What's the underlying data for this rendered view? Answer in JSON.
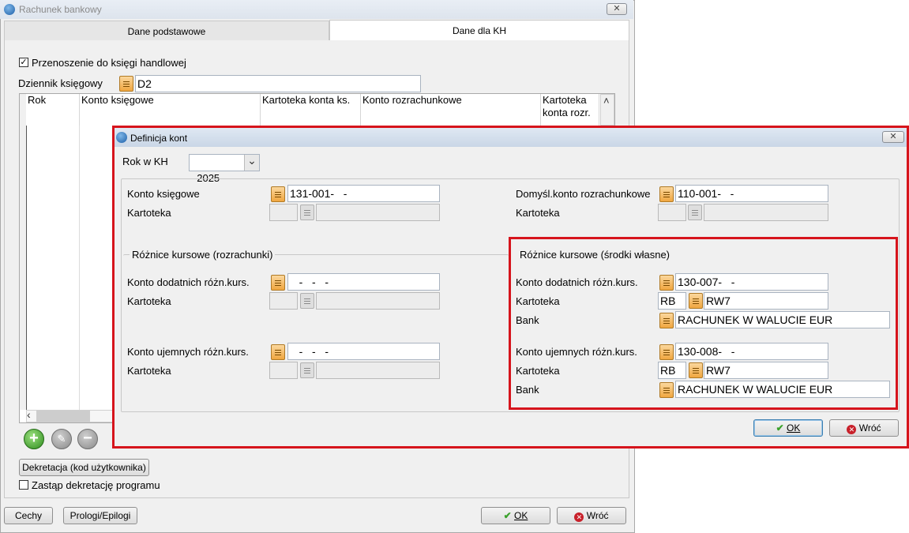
{
  "back_window": {
    "title": "Rachunek bankowy",
    "close": "✕",
    "tabs": [
      "Dane podstawowe",
      "Dane dla KH"
    ],
    "transfer_checkbox": {
      "label": "Przenoszenie do księgi handlowej",
      "checked": true,
      "mark": "✓"
    },
    "journal": {
      "label": "Dziennik księgowy",
      "value": "D2"
    },
    "grid": {
      "columns": [
        "Rok",
        "Konto księgowe",
        "Kartoteka konta ks.",
        "Konto rozrachunkowe",
        "Kartoteka konta rozr."
      ],
      "scroll_left": "‹",
      "scroll_up": "˄"
    },
    "add_icon": "+",
    "edit_icon": "✎",
    "remove_icon": "−",
    "decree_button": "Dekretacja (kod użytkownika)",
    "replace_checkbox": {
      "label": "Zastąp dekretację programu",
      "checked": false
    },
    "buttons": {
      "features": "Cechy",
      "prologs": "Prologi/Epilogi",
      "ok": "OK",
      "back": "Wróć"
    }
  },
  "dialog": {
    "title": "Definicja kont",
    "close": "✕",
    "year": {
      "label": "Rok w KH",
      "value": "2025",
      "arrow": "⌄"
    },
    "account": {
      "label": "Konto księgowe",
      "value": "131-001-   -",
      "card_label": "Kartoteka"
    },
    "default_settlement": {
      "label": "Domyśl.konto rozrachunkowe",
      "value": "110-001-   -",
      "card_label": "Kartoteka"
    },
    "fx_settlements": {
      "title": "Różnice kursowe (rozrachunki)",
      "positive": {
        "label": "Konto dodatnich różn.kurs.",
        "value": "   -   -   -",
        "card_label": "Kartoteka"
      },
      "negative": {
        "label": "Konto ujemnych różn.kurs.",
        "value": "   -   -   -",
        "card_label": "Kartoteka"
      }
    },
    "fx_own_funds": {
      "title": "Różnice kursowe (środki własne)",
      "positive": {
        "label": "Konto dodatnich różn.kurs.",
        "value": "130-007-   -",
        "card_label": "Kartoteka",
        "card_type": "RB",
        "card_value": "RW7",
        "bank_label": "Bank",
        "bank_value": "RACHUNEK W WALUCIE EUR"
      },
      "negative": {
        "label": "Konto ujemnych różn.kurs.",
        "value": "130-008-   -",
        "card_label": "Kartoteka",
        "card_type": "RB",
        "card_value": "RW7",
        "bank_label": "Bank",
        "bank_value": "RACHUNEK W WALUCIE EUR"
      }
    },
    "buttons": {
      "ok": "OK",
      "back": "Wróć"
    }
  },
  "colors": {
    "highlight": "#d6141c",
    "ok_check": "#3aa12b",
    "back_icon": "#c8202a"
  }
}
